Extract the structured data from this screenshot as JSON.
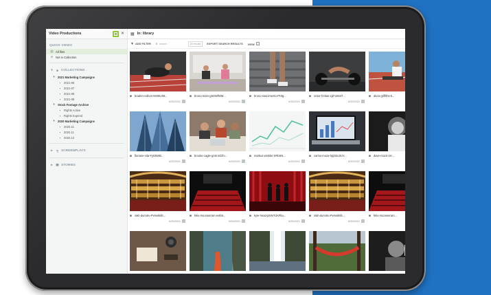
{
  "sidebar": {
    "title": "Video Productions",
    "quick_views_label": "QUICK VIEWS",
    "quick_views": [
      "All files",
      "Not in Collection"
    ],
    "collections_label": "COLLECTIONS",
    "collections": [
      {
        "label": "2021 Marketing Campaigns",
        "level": 1
      },
      {
        "label": "2021-06",
        "level": 2
      },
      {
        "label": "2021-07",
        "level": 2
      },
      {
        "label": "2021-08",
        "level": 2
      },
      {
        "label": "2021-08",
        "level": 2
      },
      {
        "label": "Stock Footage Archive",
        "level": 1
      },
      {
        "label": "Rights Active",
        "level": 2
      },
      {
        "label": "Rights Expired",
        "level": 2
      },
      {
        "label": "2020 Marketing Campaigns",
        "level": 1
      },
      {
        "label": "2020.11",
        "level": 2
      },
      {
        "label": "2020.11",
        "level": 2
      },
      {
        "label": "2020.12",
        "level": 2
      }
    ],
    "screenplays_label": "SCREENPLAYS",
    "stories_label": "STORIES"
  },
  "main": {
    "title": "In: library",
    "toolbar": {
      "add_filter": "ADD FILTER",
      "search_placeholder": "search",
      "count": "25 results",
      "export": "EXPORT SEARCH RESULTS",
      "view": "VIEW"
    },
    "assets": [
      {
        "name": "braden-collum-9HI8UJM...",
        "date": "6/25/2021",
        "thumb": "track"
      },
      {
        "name": "bruno-mars-g6GWfWM...",
        "date": "6/25/2021",
        "thumb": "gym"
      },
      {
        "name": "bruno-nascimento-PHIg...",
        "date": "6/25/2021",
        "thumb": "stairs"
      },
      {
        "name": "victor-freitas-xjZ-U8s47...",
        "date": "6/25/2021",
        "thumb": "pushup"
      },
      {
        "name": "alora-griffiths-k...",
        "date": "6/25/2021",
        "thumb": "stretch"
      },
      {
        "name": "floriane-vita-FyD5WB...",
        "date": "6/25/2021",
        "thumb": "towers"
      },
      {
        "name": "brooke-cagle-g1Kr4Ozfo...",
        "date": "6/25/2021",
        "thumb": "meeting"
      },
      {
        "name": "markus-winkler-IrRbSN...",
        "date": "6/25/2021",
        "thumb": "chart"
      },
      {
        "name": "carlos-muza-hpjSkU2UY...",
        "date": "6/25/2021",
        "thumb": "laptop"
      },
      {
        "name": "dave-mock-2H...",
        "date": "6/25/2021",
        "thumb": "portrait"
      },
      {
        "name": "vlah-dumitru-Pvmwfelb...",
        "date": "6/25/2021",
        "thumb": "theater"
      },
      {
        "name": "felix-mooneeram-evIb6...",
        "date": "6/25/2021",
        "thumb": "cinema"
      },
      {
        "name": "kyle-head-p6rNTdAPbu...",
        "date": "6/25/2021",
        "thumb": "stage"
      },
      {
        "name": "vlah-dumitru-Pvmwfelb...",
        "date": "6/25/2021",
        "thumb": "theater"
      },
      {
        "name": "felix-mooneeram...",
        "date": "6/25/2021",
        "thumb": "cinema"
      },
      {
        "name": "",
        "date": "",
        "thumb": "desk"
      },
      {
        "name": "",
        "date": "",
        "thumb": "kayak"
      },
      {
        "name": "",
        "date": "",
        "thumb": "waterfall"
      },
      {
        "name": "",
        "date": "",
        "thumb": "hammock"
      },
      {
        "name": "",
        "date": "",
        "thumb": "singer"
      }
    ]
  }
}
